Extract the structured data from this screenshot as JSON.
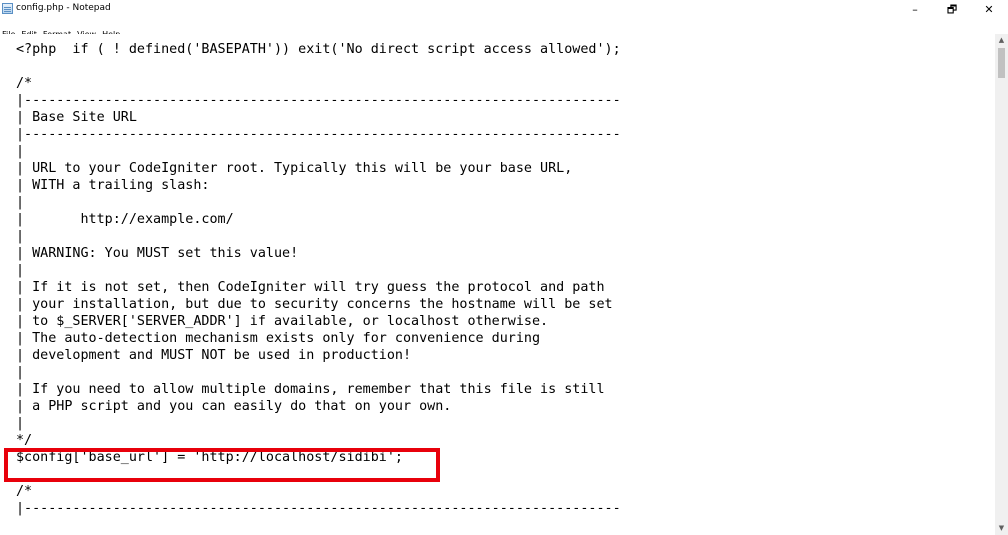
{
  "window": {
    "title": "config.php - Notepad",
    "minimize_glyph": "–",
    "maximize_glyph": "🗗",
    "close_glyph": "✕"
  },
  "menu": [
    "File",
    "Edit",
    "Format",
    "View",
    "Help"
  ],
  "editor": {
    "lines": [
      "<?php  if ( ! defined('BASEPATH')) exit('No direct script access allowed');",
      "",
      "/*",
      "|--------------------------------------------------------------------------",
      "| Base Site URL",
      "|--------------------------------------------------------------------------",
      "|",
      "| URL to your CodeIgniter root. Typically this will be your base URL,",
      "| WITH a trailing slash:",
      "|",
      "|\thttp://example.com/",
      "|",
      "| WARNING: You MUST set this value!",
      "|",
      "| If it is not set, then CodeIgniter will try guess the protocol and path",
      "| your installation, but due to security concerns the hostname will be set",
      "| to $_SERVER['SERVER_ADDR'] if available, or localhost otherwise.",
      "| The auto-detection mechanism exists only for convenience during",
      "| development and MUST NOT be used in production!",
      "|",
      "| If you need to allow multiple domains, remember that this file is still",
      "| a PHP script and you can easily do that on your own.",
      "|",
      "*/",
      "$config['base_url'] = 'http://localhost/sidibi';",
      "",
      "/*",
      "|--------------------------------------------------------------------------"
    ]
  },
  "highlight": {
    "color": "#e8000b",
    "target_line": 24
  },
  "scrollbar": {
    "up_glyph": "▲",
    "down_glyph": "▼"
  }
}
